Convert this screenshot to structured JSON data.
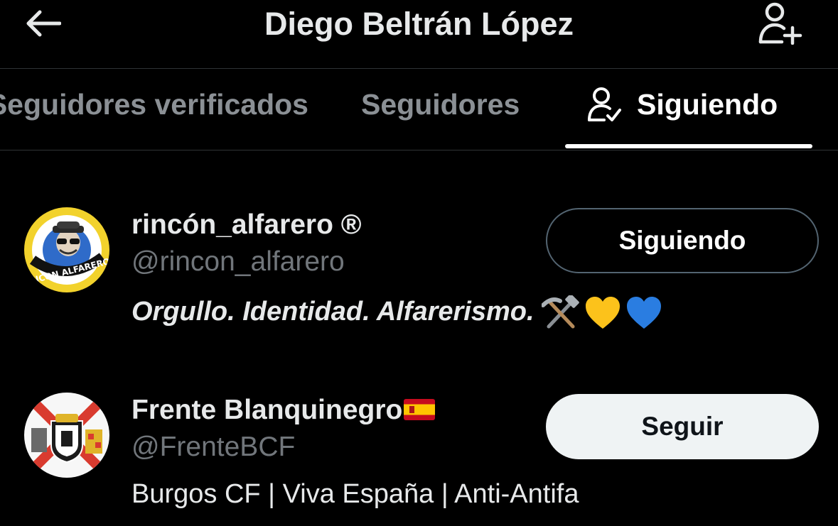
{
  "header": {
    "title": "Diego Beltrán López"
  },
  "tabs": [
    {
      "label": "Seguidores verificados"
    },
    {
      "label": "Seguidores"
    },
    {
      "label": "Siguiendo"
    }
  ],
  "users": [
    {
      "name": "rincón_alfarero ®",
      "handle": "@rincon_alfarero",
      "bio_text": "Orgullo. Identidad. Alfarerismo.",
      "bio_emojis": [
        "hammer-and-pick",
        "yellow-heart",
        "blue-heart"
      ],
      "avatar_text": "RINCON ALFARERO",
      "button_label": "Siguiendo"
    },
    {
      "name": "Frente Blanquinegro",
      "name_flag": "spain-flag",
      "handle": "@FrenteBCF",
      "bio_text": "Burgos CF | Viva España | Anti-Antifa",
      "button_label": "Seguir"
    }
  ],
  "colors": {
    "background": "#000000",
    "text": "#e7e9ea",
    "muted": "#71767b",
    "follow_button": "#eff3f4"
  }
}
